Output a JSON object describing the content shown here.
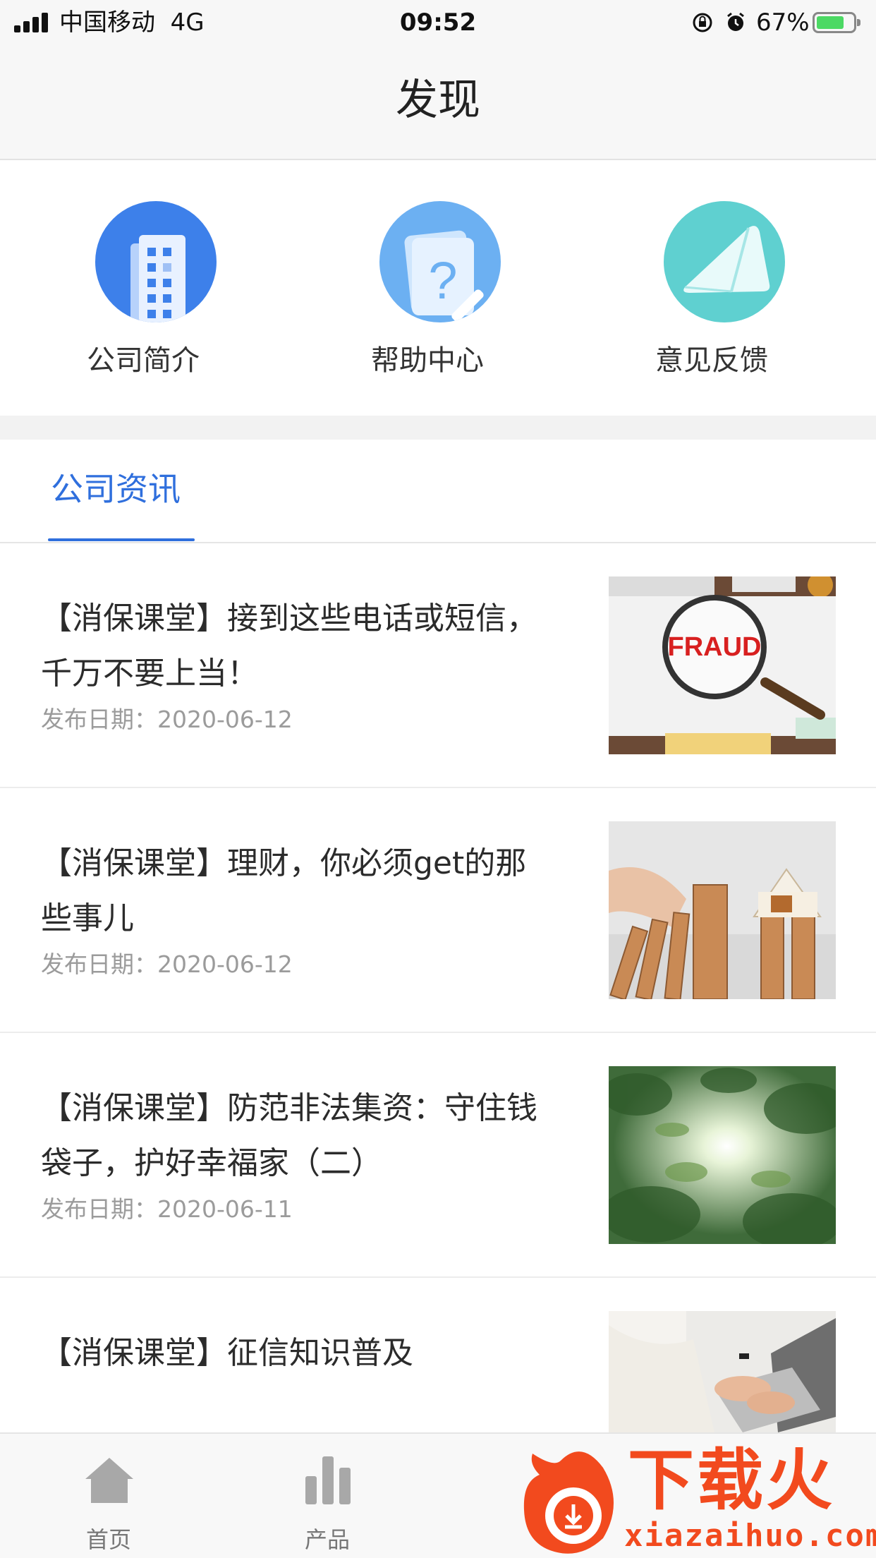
{
  "status_bar": {
    "carrier": "中国移动",
    "network": "4G",
    "time": "09:52",
    "battery_percent": "67%",
    "icons": [
      "signal-icon",
      "rotation-lock-icon",
      "alarm-icon",
      "battery-icon"
    ]
  },
  "nav": {
    "title": "发现"
  },
  "entries": [
    {
      "label": "公司简介",
      "icon": "building-icon",
      "color": "#3d80ea"
    },
    {
      "label": "帮助中心",
      "icon": "help-icon",
      "color": "#6cb0f2"
    },
    {
      "label": "意见反馈",
      "icon": "envelope-icon",
      "color": "#5fd0d0"
    }
  ],
  "tabs": {
    "active_label": "公司资讯",
    "accent_color": "#2f6fdd"
  },
  "news": [
    {
      "title": "【消保课堂】接到这些电话或短信，千万不要上当！",
      "date": "发布日期：2020-06-12",
      "thumb_text": "FRAUD"
    },
    {
      "title": "【消保课堂】理财，你必须get的那些事儿",
      "date": "发布日期：2020-06-12"
    },
    {
      "title": "【消保课堂】防范非法集资：守住钱袋子，护好幸福家（二）",
      "date": "发布日期：2020-06-11"
    },
    {
      "title": "【消保课堂】征信知识普及",
      "date": ""
    }
  ],
  "bottom_tabs": [
    {
      "label": "首页",
      "icon": "home-icon"
    },
    {
      "label": "产品",
      "icon": "bar-chart-icon"
    }
  ],
  "watermark": {
    "text": "下载火",
    "url": "xiazaihuo.com"
  }
}
